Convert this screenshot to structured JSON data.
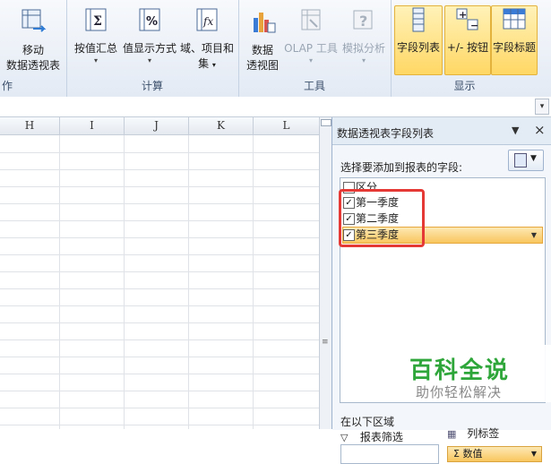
{
  "ribbon": {
    "partial_label": "作",
    "move_pivot": {
      "line1": "移动",
      "line2": "数据透视表"
    },
    "groups": {
      "calc": {
        "label": "计算",
        "buttons": [
          {
            "label": "按值汇总",
            "caret": "▾"
          },
          {
            "label": "值显示方式",
            "caret": "▾"
          },
          {
            "label_line1": "域、项目和",
            "label_line2": "集",
            "caret": "▾"
          }
        ]
      },
      "tools": {
        "label": "工具",
        "buttons": [
          {
            "label_line1": "数据",
            "label_line2": "透视图"
          },
          {
            "label": "OLAP 工具",
            "caret": "▾"
          },
          {
            "label": "模拟分析",
            "caret": "▾"
          }
        ]
      },
      "show": {
        "label": "显示",
        "buttons": [
          {
            "label": "字段列表"
          },
          {
            "label": "+/- 按钮"
          },
          {
            "label": "字段标题"
          }
        ]
      }
    }
  },
  "sheet": {
    "columns": [
      "H",
      "I",
      "J",
      "K",
      "L"
    ]
  },
  "field_pane": {
    "title": "数据透视表字段列表",
    "menu_icon": "▼",
    "close_icon": "×",
    "choose_label": "选择要添加到报表的字段:",
    "fields": [
      {
        "label": "区分",
        "checked": "",
        "selected": false
      },
      {
        "label": "第一季度",
        "checked": "✓",
        "selected": false
      },
      {
        "label": "第二季度",
        "checked": "✓",
        "selected": false
      },
      {
        "label": "第三季度",
        "checked": "✓",
        "selected": true
      }
    ],
    "area_label": "在以下区域",
    "filter_label": "报表筛选",
    "column_label": "列标签",
    "value_chip": "Σ  数值"
  },
  "watermark": {
    "title": "百科全说",
    "subtitle": "助你轻松解决"
  },
  "colors": {
    "accent_active": "#ffd764",
    "highlight": "#e53935",
    "watermark": "#2fa63a"
  }
}
